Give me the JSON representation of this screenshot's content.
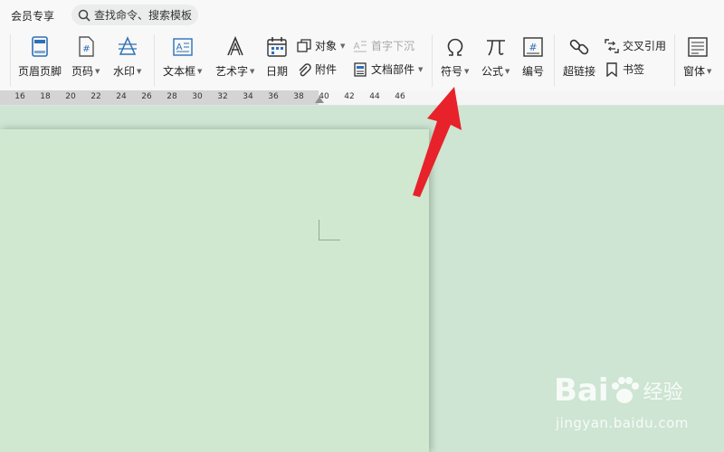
{
  "tabbar": {
    "member_tab": "会员专享",
    "search_text": "查找命令、搜索模板"
  },
  "tools": {
    "header_footer": "页眉页脚",
    "page_number": "页码",
    "watermark": "水印",
    "text_box": "文本框",
    "art_text": "艺术字",
    "date": "日期",
    "object": "对象",
    "drop_cap": "首字下沉",
    "attachment": "附件",
    "doc_parts": "文档部件",
    "symbol": "符号",
    "formula": "公式",
    "numbering": "编号",
    "hyperlink": "超链接",
    "cross_ref": "交叉引用",
    "bookmark": "书签",
    "window": "窗体"
  },
  "ruler": {
    "ticks": [
      "16",
      "18",
      "20",
      "22",
      "24",
      "26",
      "28",
      "30",
      "32",
      "34",
      "36",
      "38",
      "40",
      "42",
      "44",
      "46"
    ]
  },
  "watermark": {
    "brand": "Bai",
    "brand_cn": "经验",
    "url": "jingyan.baidu.com"
  },
  "colors": {
    "ribbon_bg": "#f7f8f7",
    "page_bg": "#cfe8cf",
    "workspace_bg": "#cde5d2",
    "arrow_red": "#e8222a",
    "icon_blue": "#2e6fb7"
  }
}
